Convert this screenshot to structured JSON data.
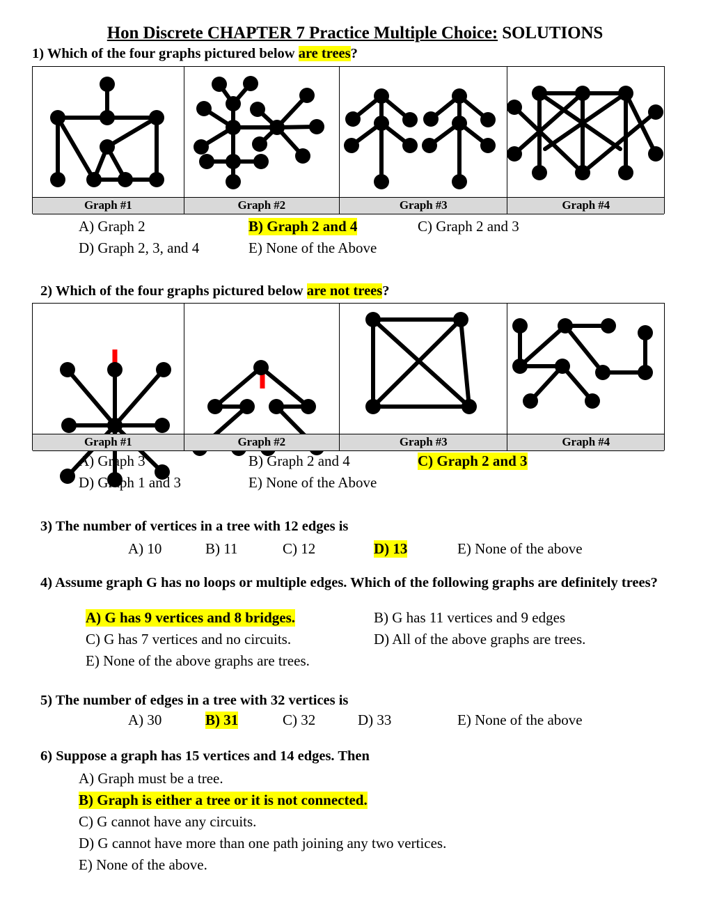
{
  "document": {
    "title_underlined": "Hon Discrete CHAPTER 7 Practice Multiple Choice:",
    "title_plain": " SOLUTIONS",
    "highlight_color": "#ffff00",
    "label_row_bg": "#d9d9d9",
    "mark_color": "#ff0000"
  },
  "q1": {
    "stem_pre": "1) Which of the four graphs pictured below ",
    "stem_hl": "are trees",
    "stem_post": "?",
    "graph_labels": [
      "Graph #1",
      "Graph #2",
      "Graph #3",
      "Graph #4"
    ],
    "options": {
      "a": "A) Graph 2",
      "b": "B) Graph 2 and 4",
      "c": "C) Graph 2 and 3",
      "d": "D) Graph 2, 3, and 4",
      "e": "E) None of the Above"
    },
    "answer": "B"
  },
  "q2": {
    "stem_pre": "2) Which of the four graphs pictured below ",
    "stem_hl": "are not trees",
    "stem_post": "?",
    "graph_labels": [
      "Graph #1",
      "Graph #2",
      "Graph #3",
      "Graph #4"
    ],
    "options": {
      "a": "A) Graph 3",
      "b": "B) Graph 2 and 4",
      "c": "C) Graph 2 and 3",
      "d": "D) Graph 1 and 3",
      "e": "E) None of the Above"
    },
    "answer": "C"
  },
  "q3": {
    "stem": "3) The number of vertices in a tree with 12 edges is",
    "options": {
      "a": "A) 10",
      "b": "B) 11",
      "c": "C) 12",
      "d": "D) 13",
      "e": "E) None of the above"
    },
    "answer": "D"
  },
  "q4": {
    "stem": "4)   Assume graph G has no loops or multiple edges. Which of the following graphs are definitely trees?",
    "options": {
      "a": "A) G has 9 vertices and 8 bridges.",
      "b": "B) G has 11 vertices and 9 edges",
      "c": "C) G has 7 vertices and no circuits.",
      "d": "D) All of the above graphs are trees.",
      "e": "E) None of the above graphs are trees."
    },
    "answer": "A"
  },
  "q5": {
    "stem": "5) The number of edges in a tree with 32 vertices is",
    "options": {
      "a": "A) 30",
      "b": "B) 31",
      "c": "C) 32",
      "d": "D) 33",
      "e": "E) None of the above"
    },
    "answer": "B"
  },
  "q6": {
    "stem": "6) Suppose a graph has 15 vertices and 14 edges. Then",
    "options": {
      "a": "A) Graph must be a tree.",
      "b": "B) Graph is either a tree or it is not connected.",
      "c": "C) G cannot have any circuits.",
      "d": "D) G cannot have more than one path joining any two vertices.",
      "e": "E) None of the above."
    },
    "answer": "B"
  }
}
